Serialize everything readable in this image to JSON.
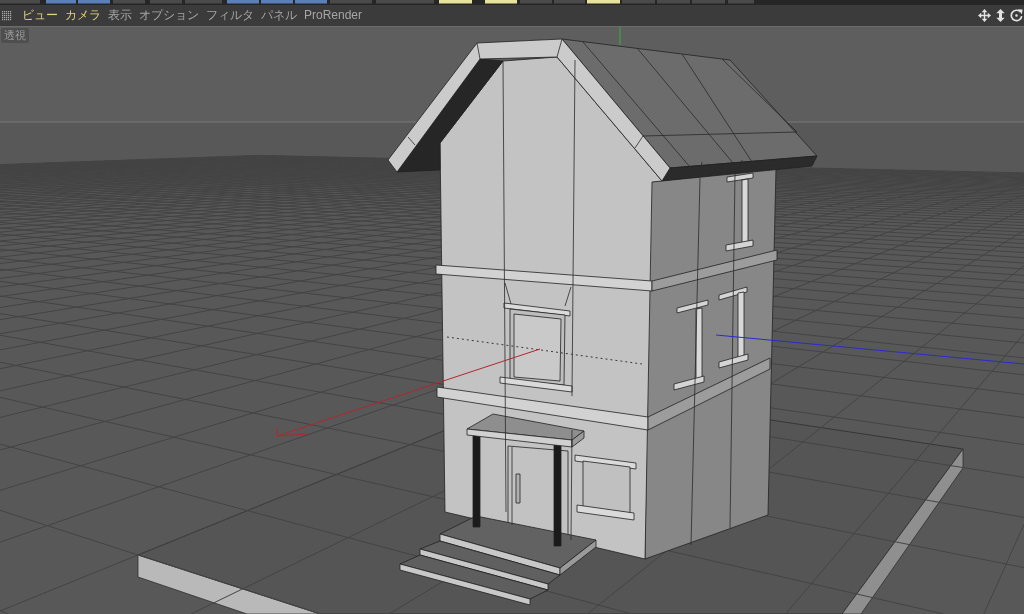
{
  "menu_bar": {
    "items": [
      {
        "label": "ビュー",
        "highlighted": true
      },
      {
        "label": "カメラ",
        "highlighted": true
      },
      {
        "label": "表示",
        "highlighted": false
      },
      {
        "label": "オプション",
        "highlighted": false
      },
      {
        "label": "フィルタ",
        "highlighted": false
      },
      {
        "label": "パネル",
        "highlighted": false
      },
      {
        "label": "ProRender",
        "highlighted": false
      }
    ]
  },
  "viewport": {
    "view_label": "透視"
  }
}
